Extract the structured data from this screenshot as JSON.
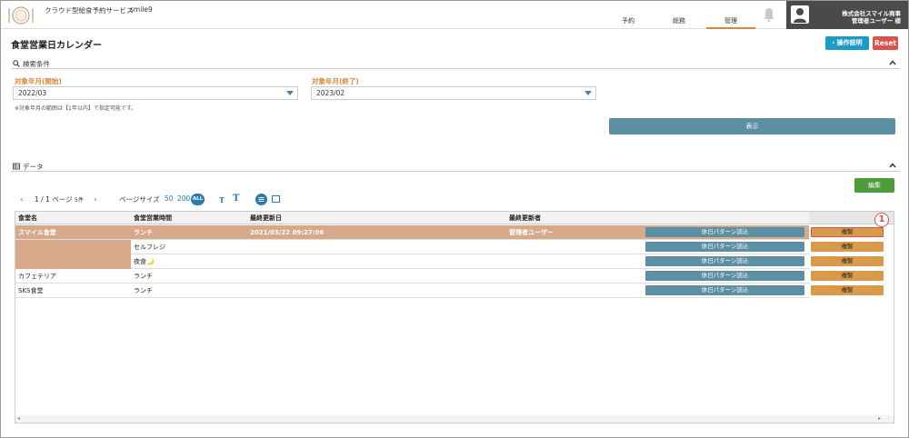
{
  "header": {
    "app_title": "クラウド型給食予約サービス",
    "app_user": "smile9",
    "tabs": [
      {
        "label": "予約"
      },
      {
        "label": "総務"
      },
      {
        "label": "管理"
      }
    ],
    "company": "株式会社スマイル商事",
    "user": "管理者ユーザー 様"
  },
  "page": {
    "title": "食堂営業日カレンダー",
    "manual_button": "‹ 操作説明",
    "reset_button": "Reset"
  },
  "search": {
    "section_label": "検索条件",
    "start_label": "対象年月(開始)",
    "start_value": "2022/03",
    "end_label": "対象年月(終了)",
    "end_value": "2023/02",
    "note": "※対象年月の範囲は【1年以内】で指定可能です。",
    "show_button": "表示"
  },
  "data_section": {
    "section_label": "データ",
    "edit_button": "編集",
    "pager_text": "1 / 1 ページ",
    "count_text": "5件",
    "pagesize_label": "ページサイズ",
    "pagesize_50": "50",
    "pagesize_200": "200",
    "pagesize_all": "ALL",
    "font_small_icon": "T",
    "font_large_icon": "T"
  },
  "table": {
    "columns": [
      "食堂名",
      "食堂営業時間",
      "最終更新日",
      "最終更新者"
    ],
    "pattern_button": "休日パターン読込",
    "copy_button": "複製",
    "rows": [
      {
        "canteen": "スマイル食堂",
        "time": "ランチ",
        "updated": "2021/03/22 09:27:06",
        "updater": "管理者ユーザー"
      },
      {
        "canteen": "",
        "time": "セルフレジ",
        "updated": "",
        "updater": ""
      },
      {
        "canteen": "",
        "time": "夜食🌙",
        "updated": "",
        "updater": ""
      },
      {
        "canteen": "カフェテリア",
        "time": "ランチ",
        "updated": "",
        "updater": ""
      },
      {
        "canteen": "SKS食堂",
        "time": "ランチ",
        "updated": "",
        "updater": ""
      }
    ]
  },
  "callout": "1"
}
